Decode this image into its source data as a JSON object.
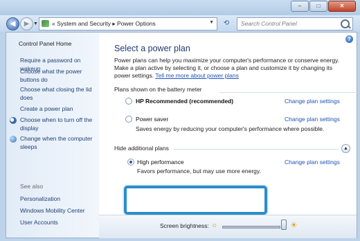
{
  "window": {
    "controls": {
      "minimize": "–",
      "maximize": "□",
      "close": "✕"
    },
    "colors": {
      "accent": "#2b8dc9",
      "link": "#1f53b3",
      "nav": "#1f3f74"
    }
  },
  "address": {
    "breadcrumb": "« System and Security ▸ Power Options",
    "search_placeholder": "Search Control Panel"
  },
  "sidebar": {
    "home": "Control Panel Home",
    "items": [
      "Require a password on wakeup",
      "Choose what the power buttons do",
      "Choose what closing the lid does",
      "Create a power plan",
      "Choose when to turn off the display",
      "Change when the computer sleeps"
    ],
    "see_also": "See also",
    "see_also_items": [
      "Personalization",
      "Windows Mobility Center",
      "User Accounts"
    ]
  },
  "main": {
    "title": "Select a power plan",
    "intro": "Power plans can help you maximize your computer's performance or conserve energy. Make a plan active by selecting it, or choose a plan and customize it by changing its power settings.",
    "intro_link": "Tell me more about power plans",
    "section_battery": "Plans shown on the battery meter",
    "section_hidden": "Hide additional plans",
    "change_label": "Change plan settings",
    "plans": [
      {
        "name": "HP Recommended (recommended)",
        "desc": "",
        "selected": false
      },
      {
        "name": "Power saver",
        "desc": "Saves energy by reducing your computer's performance where possible.",
        "selected": false
      },
      {
        "name": "High performance",
        "desc": "Favors performance, but may use more energy.",
        "selected": true
      }
    ]
  },
  "brightness": {
    "label": "Screen brightness:",
    "level_percent": 100
  }
}
